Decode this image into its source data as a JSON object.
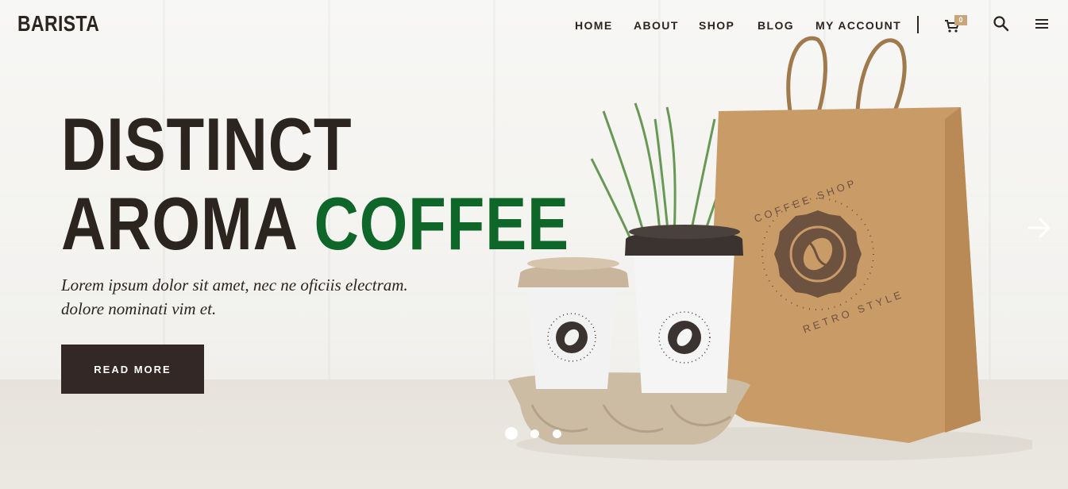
{
  "brand": {
    "logo": "BARISTA"
  },
  "nav": {
    "items": [
      "HOME",
      "ABOUT",
      "SHOP",
      "BLOG",
      "MY ACCOUNT"
    ],
    "cart_count": "0"
  },
  "hero": {
    "line1": "DISTINCT",
    "line2_a": "AROMA",
    "line2_b": "COFFEE",
    "subtitle_line1": "Lorem ipsum dolor sit amet, nec ne oficiis electram.",
    "subtitle_line2": "dolore nominati vim et.",
    "button_label": "READ MORE"
  },
  "product": {
    "stamp_top": "COFFEE SHOP",
    "stamp_bottom": "RETRO STYLE"
  },
  "slider": {
    "active_index": 0,
    "count": 3
  },
  "colors": {
    "text_dark": "#2b241f",
    "accent_green": "#0e6628",
    "button_bg": "#332826",
    "badge": "#c8a67a"
  },
  "icons": [
    "cart-icon",
    "search-icon",
    "hamburger-menu-icon",
    "next-arrow-icon"
  ]
}
